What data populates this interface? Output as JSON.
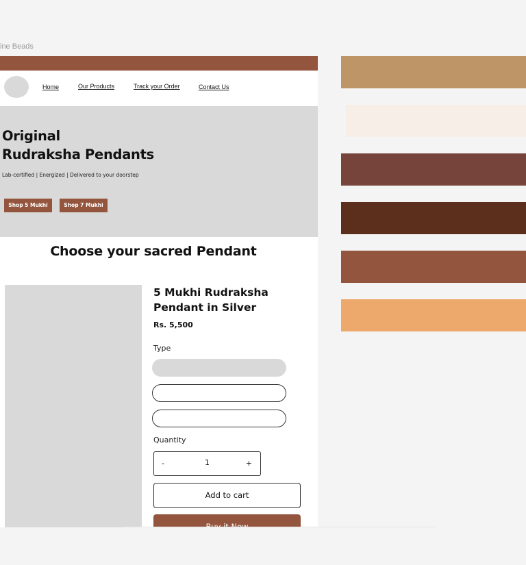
{
  "frame": {
    "label": "ine Beads"
  },
  "nav": {
    "links": [
      "Home",
      "Our Products",
      "Track your Order",
      "Contact Us"
    ]
  },
  "hero": {
    "title_line1": "Original",
    "title_line2": "Rudraksha Pendants",
    "subtitle": "Lab-certified | Energized | Delivered to your doorstep",
    "btn_primary": "Shop 5 Mukhi",
    "btn_secondary": "Shop 7 Mukhi"
  },
  "section": {
    "title": "Choose your sacred Pendant"
  },
  "product": {
    "title": "5 Mukhi Rudraksha Pendant in Silver",
    "price": "Rs. 5,500",
    "type_label": "Type",
    "quantity_label": "Quantity",
    "quantity_minus": "-",
    "quantity_value": "1",
    "quantity_plus": "+",
    "add_to_cart": "Add to cart",
    "buy_now": "Buy it Now"
  },
  "palette": [
    "#be9566",
    "#f7efe7",
    "#77443b",
    "#5b2f1c",
    "#93553d",
    "#eda96b"
  ],
  "colors": {
    "accent": "#93553d",
    "placeholder": "#d9d9d9"
  }
}
